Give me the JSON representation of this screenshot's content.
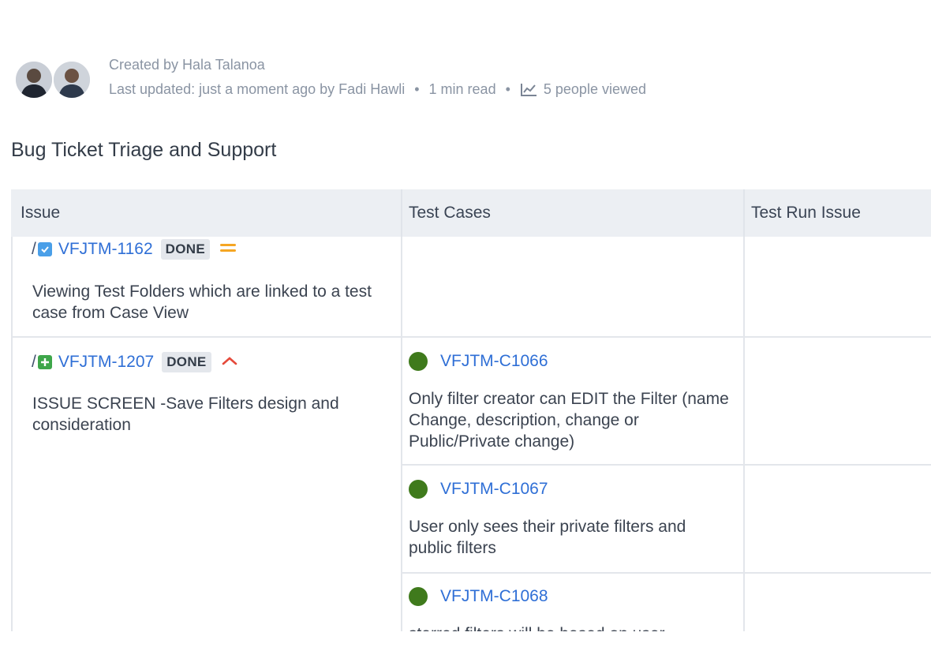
{
  "meta": {
    "created_by": "Created by Hala Talanoa",
    "last_updated": "Last updated: just a moment ago by Fadi Hawli",
    "sep": "•",
    "read_time": "1 min read",
    "views": "5 people viewed",
    "views_icon": "analytics-chart-icon"
  },
  "page": {
    "title": "Bug Ticket Triage and Support"
  },
  "table": {
    "headers": [
      "Issue",
      "Test Cases",
      "Test Run Issue"
    ],
    "rows": [
      {
        "issue": {
          "prefix": "/",
          "type_icon": "task-checkbox-icon",
          "key": "VFJTM-1162",
          "status": "DONE",
          "priority_icon": "medium-priority-icon",
          "summary": "Viewing Test Folders which are linked to a test case from Case View"
        },
        "test_cases": []
      },
      {
        "issue": {
          "prefix": "/",
          "type_icon": "story-plus-icon",
          "key": "VFJTM-1207",
          "status": "DONE",
          "priority_icon": "high-priority-icon",
          "summary": "ISSUE SCREEN -Save Filters design and consideration"
        },
        "test_cases": [
          {
            "key": "VFJTM-C1066",
            "description": "Only filter creator can EDIT the Filter (name Change, description, change or Public/Private change)",
            "status_color": "#3f7a1c"
          },
          {
            "key": "VFJTM-C1067",
            "description": "User only sees their private filters and public filters",
            "status_color": "#3f7a1c"
          },
          {
            "key": "VFJTM-C1068",
            "description": "starred filters will be based on user",
            "status_color": "#3f7a1c"
          }
        ]
      }
    ]
  }
}
